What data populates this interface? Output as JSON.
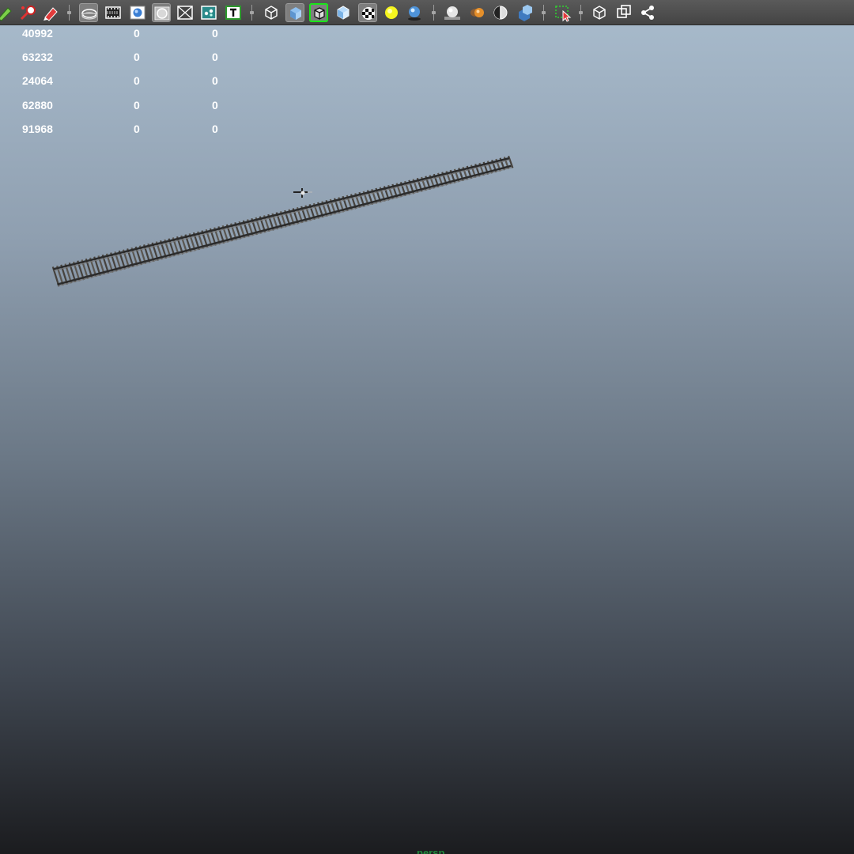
{
  "viewport": {
    "background_top": "#a9bccd",
    "background_bottom": "#1b1c1f"
  },
  "toolbar": {
    "background": "#4a4a4a",
    "accent_highlight": "#19e619",
    "buttons": [
      {
        "icon": "select-camera-icon"
      },
      {
        "icon": "camera-attributes-icon"
      },
      {
        "icon": "bookmark-icon"
      },
      {
        "icon": "image-plane-icon"
      },
      {
        "icon": "film-gate-icon"
      },
      {
        "icon": "resolution-gate-icon"
      },
      {
        "icon": "gate-mask-icon"
      },
      {
        "icon": "field-chart-icon"
      },
      {
        "icon": "safe-action-icon"
      },
      {
        "icon": "safe-title-icon"
      },
      {
        "icon": "wireframe-icon"
      },
      {
        "icon": "smooth-shade-icon"
      },
      {
        "icon": "wireframe-on-shaded-icon"
      },
      {
        "icon": "xray-icon"
      },
      {
        "icon": "textured-icon"
      },
      {
        "icon": "use-all-lights-icon"
      },
      {
        "icon": "shadows-icon"
      },
      {
        "icon": "screen-space-ao-icon"
      },
      {
        "icon": "motion-blur-icon"
      },
      {
        "icon": "anti-aliasing-icon"
      },
      {
        "icon": "depth-of-field-icon"
      },
      {
        "icon": "isolate-select-icon"
      },
      {
        "icon": "xray-joints-icon"
      },
      {
        "icon": "xray-active-components-icon"
      },
      {
        "icon": "share-icon"
      }
    ]
  },
  "heads_up_display": {
    "rows": [
      [
        "40992",
        "0",
        "0"
      ],
      [
        "63232",
        "0",
        "0"
      ],
      [
        "24064",
        "0",
        "0"
      ],
      [
        "62880",
        "0",
        "0"
      ],
      [
        "91968",
        "0",
        "0"
      ]
    ]
  },
  "scene": {
    "object": "railway-track-model",
    "object_color": "#2b2b2b",
    "sleeper_color": "#5a5650"
  },
  "bottom_label": "persp"
}
